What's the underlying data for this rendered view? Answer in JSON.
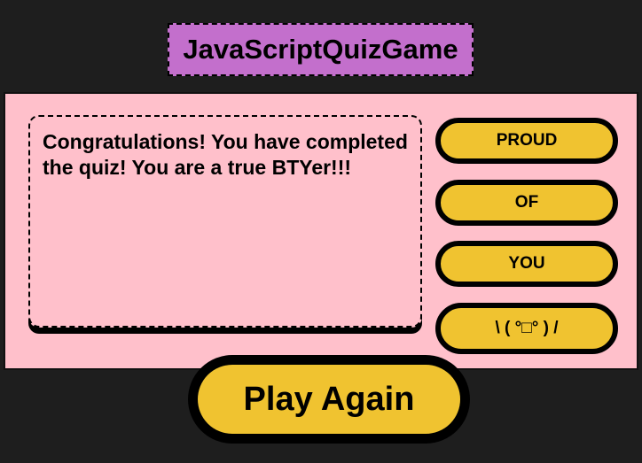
{
  "header": {
    "title": "JavaScriptQuizGame"
  },
  "quiz": {
    "message": "Congratulations! You have completed the quiz! You are a true BTYer!!!",
    "answers": [
      {
        "label": "PROUD"
      },
      {
        "label": "OF"
      },
      {
        "label": "YOU"
      },
      {
        "label": "\\ ( °□° ) /"
      }
    ]
  },
  "controls": {
    "play_again_label": "Play Again"
  },
  "colors": {
    "background": "#1e1e1e",
    "title_bg": "#c36fcc",
    "panel_bg": "#ffc0cb",
    "button_bg": "#f0c330",
    "border": "#000000"
  }
}
